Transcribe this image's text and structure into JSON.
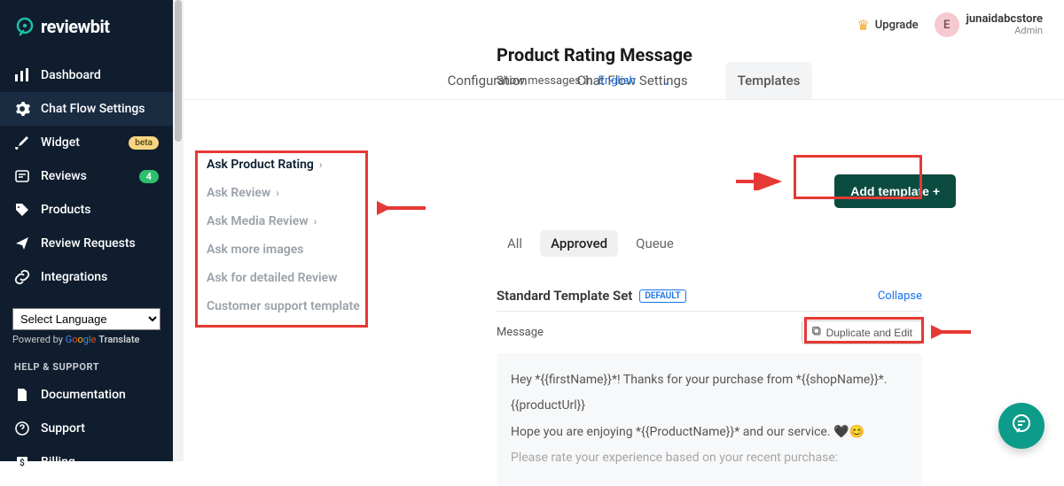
{
  "brand": {
    "name": "reviewbit"
  },
  "sidebar": {
    "items": [
      {
        "label": "Dashboard"
      },
      {
        "label": "Chat Flow Settings"
      },
      {
        "label": "Widget",
        "badge": "beta"
      },
      {
        "label": "Reviews",
        "count": "4"
      },
      {
        "label": "Products"
      },
      {
        "label": "Review Requests"
      },
      {
        "label": "Integrations"
      }
    ],
    "language_selected": "Select Language",
    "powered_prefix": "Powered by ",
    "powered_brand_parts": [
      "G",
      "o",
      "o",
      "g",
      "l",
      "e"
    ],
    "powered_translate": "Translate",
    "help_header": "HELP & SUPPORT",
    "help_items": [
      {
        "label": "Documentation"
      },
      {
        "label": "Support"
      },
      {
        "label": "Billing"
      }
    ]
  },
  "topbar": {
    "upgrade": "Upgrade",
    "avatar_letter": "E",
    "user_name": "junaidabcstore",
    "user_role": "Admin"
  },
  "tabs": [
    {
      "label": "Configuration"
    },
    {
      "label": "Chat Flow Settings"
    },
    {
      "label": "Templates"
    }
  ],
  "template_types": [
    {
      "label": "Ask Product Rating",
      "hasChevron": true,
      "active": true
    },
    {
      "label": "Ask Review",
      "hasChevron": true
    },
    {
      "label": "Ask Media Review",
      "hasChevron": true
    },
    {
      "label": "Ask more images"
    },
    {
      "label": "Ask for detailed Review"
    },
    {
      "label": "Customer support template"
    }
  ],
  "main": {
    "title": "Product Rating Message",
    "show_messages_in": "Show messages in",
    "language": "English",
    "add_template_label": "Add template +"
  },
  "filters": [
    {
      "label": "All"
    },
    {
      "label": "Approved"
    },
    {
      "label": "Queue"
    }
  ],
  "template_set": {
    "title": "Standard Template Set",
    "default_tag": "DEFAULT",
    "collapse": "Collapse",
    "message_label": "Message",
    "duplicate_label": "Duplicate and Edit",
    "body_lines": [
      "Hey *{{firstName}}*! Thanks for your purchase from *{{shopName}}*.",
      "{{productUrl}}",
      "Hope you are enjoying *{{ProductName}}* and our service. 🖤😊",
      "Please rate your experience based on your recent purchase:"
    ]
  }
}
